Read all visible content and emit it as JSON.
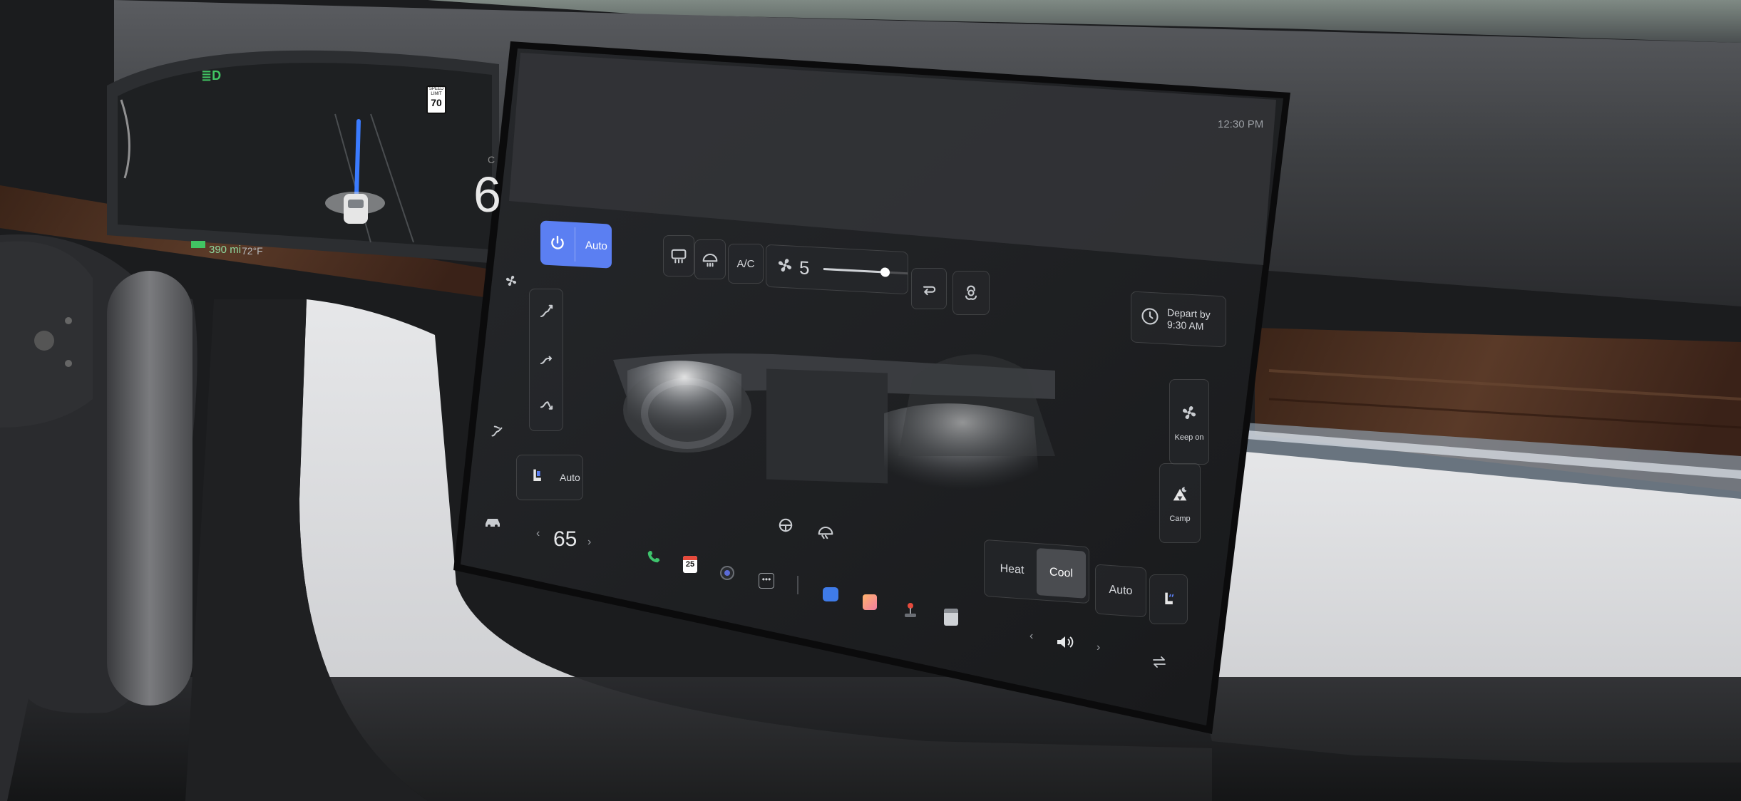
{
  "cluster": {
    "speed": "6",
    "gear": "C",
    "range": "390 mi",
    "outside_temp": "72°F",
    "speed_limit_label": "SPEED LIMIT",
    "speed_limit_value": "70",
    "indicator_icon": "headlight-icon"
  },
  "screen": {
    "clock": "12:30 PM",
    "climate": {
      "power_label": "Auto",
      "ac_label": "A/C",
      "fan_speed": "5",
      "fan_level_fraction": 0.72,
      "depart_label_line1": "Depart by",
      "depart_label_line2": "9:30 AM",
      "keep_on_label": "Keep on",
      "camp_label": "Camp",
      "seat_auto_label": "Auto",
      "heat_label": "Heat",
      "cool_label": "Cool",
      "mode_auto_label": "Auto",
      "selected_mode": "Cool"
    },
    "bottom_bar": {
      "temperature": "65",
      "calendar_day": "25",
      "icons": [
        "car-icon",
        "phone-icon",
        "calendar-icon",
        "camera-icon",
        "more-icon",
        "messages-icon",
        "photos-icon",
        "joystick-icon",
        "notes-icon",
        "volume-icon",
        "swap-icon"
      ]
    }
  },
  "colors": {
    "accent": "#5b7ff2",
    "screen_bg": "#1e1f22",
    "cluster_green": "#41c463"
  }
}
